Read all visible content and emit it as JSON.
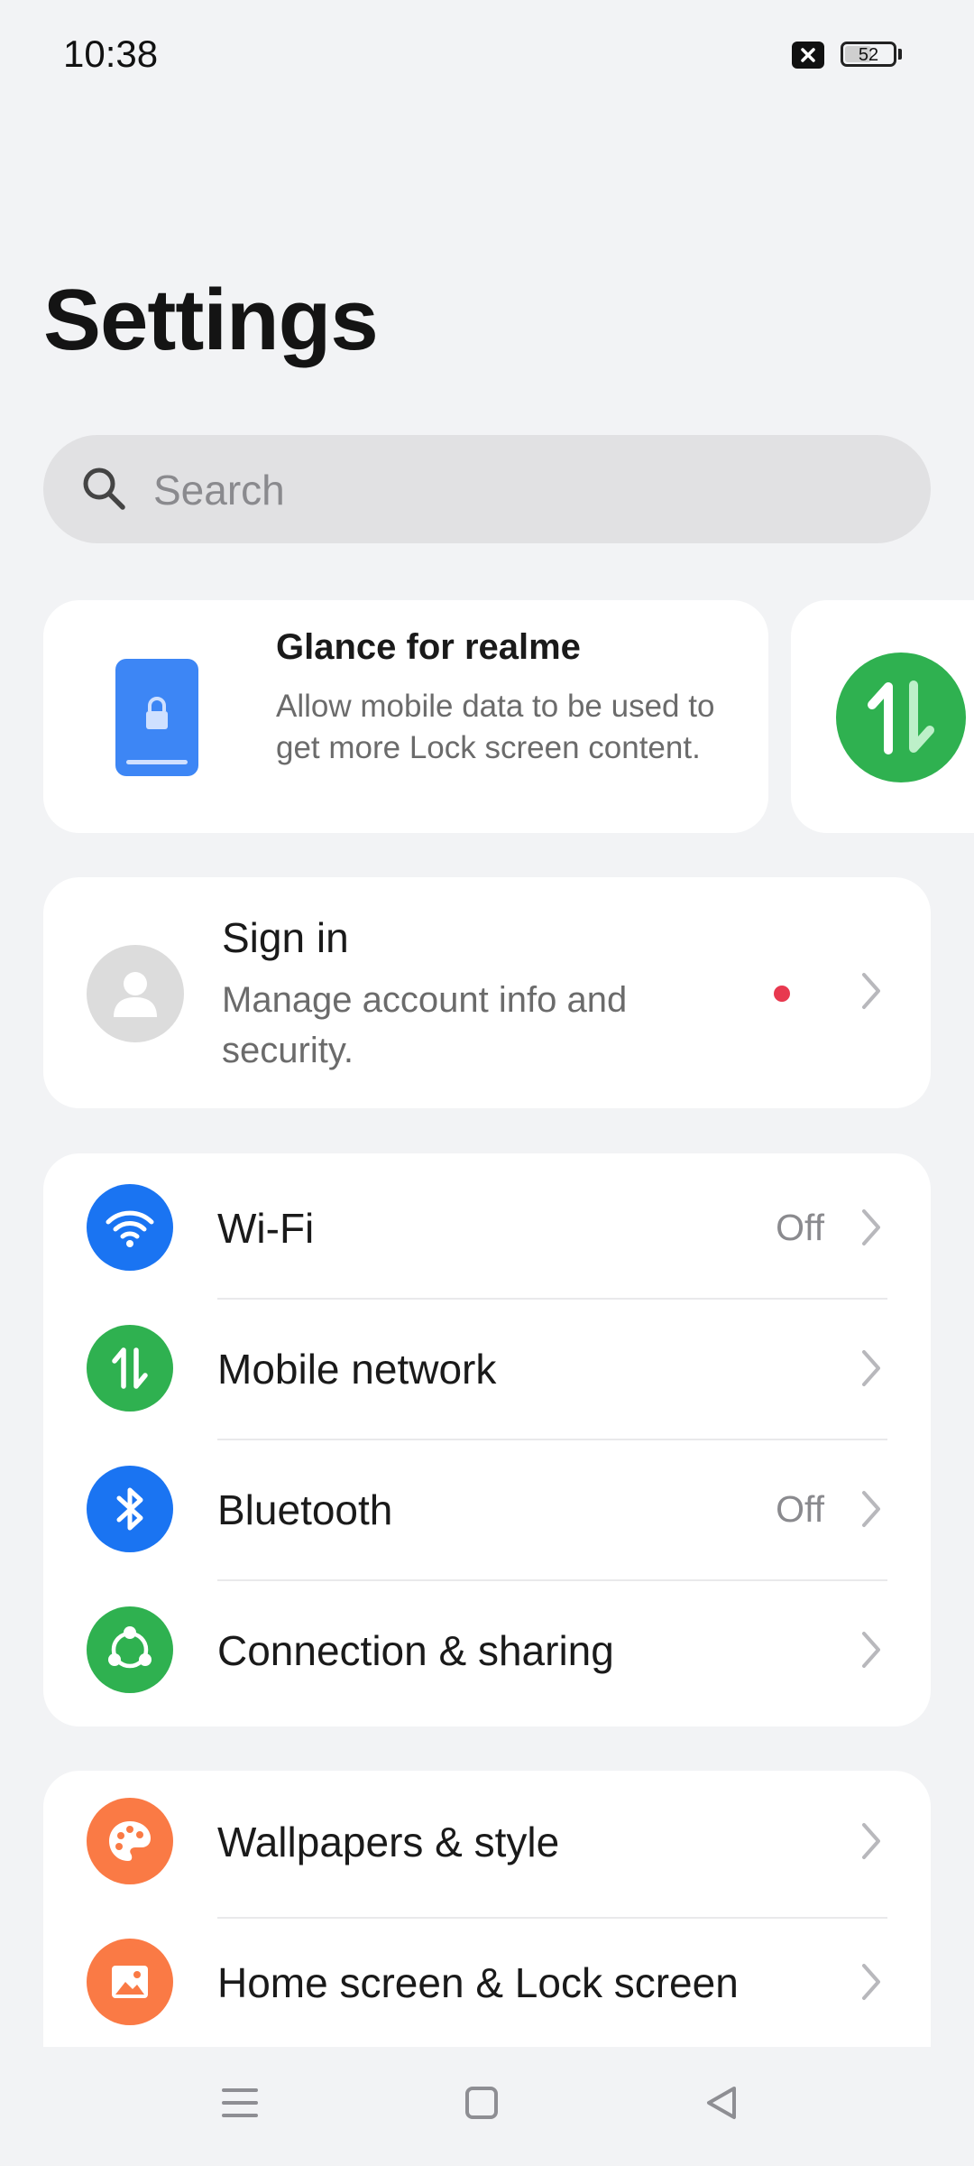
{
  "status_bar": {
    "time": "10:38",
    "battery": "52",
    "battery_level": 0.52
  },
  "page": {
    "title": "Settings"
  },
  "search": {
    "placeholder": "Search"
  },
  "promo": {
    "title": "Glance for realme",
    "description": "Allow mobile data to be used to get more Lock screen content."
  },
  "account": {
    "title": "Sign in",
    "description": "Manage account info and security."
  },
  "connectivity": [
    {
      "label": "Wi-Fi",
      "value": "Off",
      "icon": "wifi-icon",
      "color": "#1a74f2"
    },
    {
      "label": "Mobile network",
      "value": "",
      "icon": "mobile-network-icon",
      "color": "#2fb150"
    },
    {
      "label": "Bluetooth",
      "value": "Off",
      "icon": "bluetooth-icon",
      "color": "#1a74f2"
    },
    {
      "label": "Connection & sharing",
      "value": "",
      "icon": "connection-sharing-icon",
      "color": "#2fb150"
    }
  ],
  "personalization": [
    {
      "label": "Wallpapers & style",
      "icon": "palette-icon",
      "color": "#fa7a45"
    },
    {
      "label": "Home screen & Lock screen",
      "icon": "image-icon",
      "color": "#fa7a45"
    }
  ],
  "colors": {
    "background": "#f2f3f5",
    "card": "#ffffff",
    "notification_dot": "#e8384f"
  }
}
